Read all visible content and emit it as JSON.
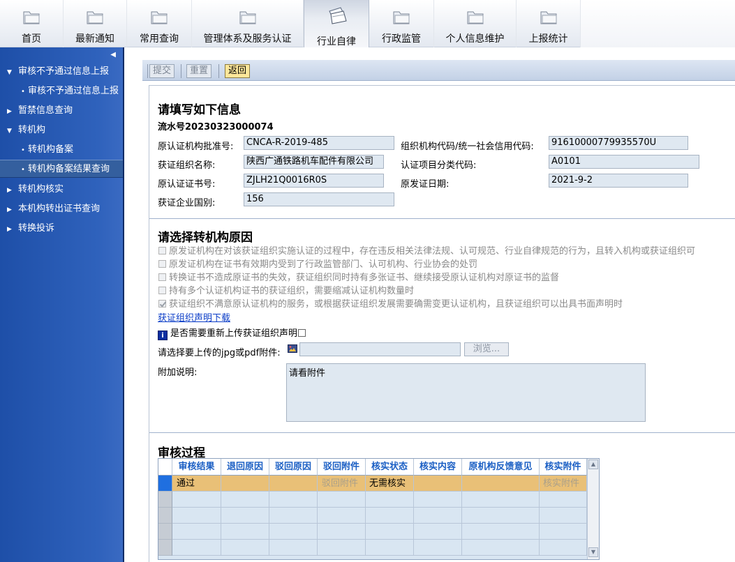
{
  "topnav": {
    "tabs": [
      {
        "label": "首页"
      },
      {
        "label": "最新通知"
      },
      {
        "label": "常用查询"
      },
      {
        "label": "管理体系及服务认证"
      },
      {
        "label": "行业自律"
      },
      {
        "label": "行政监管"
      },
      {
        "label": "个人信息维护"
      },
      {
        "label": "上报统计"
      }
    ],
    "active_tab": "行业自律"
  },
  "sidebar": {
    "collapse_glyph": "◀",
    "items": [
      {
        "label": "审核不予通过信息上报",
        "type": "group",
        "expanded": true
      },
      {
        "label": "审核不予通过信息上报",
        "type": "sub"
      },
      {
        "label": "暂禁信息查询",
        "type": "group",
        "expanded": false
      },
      {
        "label": "转机构",
        "type": "group",
        "expanded": true
      },
      {
        "label": "转机构备案",
        "type": "sub"
      },
      {
        "label": "转机构备案结果查询",
        "type": "sub",
        "selected": true
      },
      {
        "label": "转机构核实",
        "type": "group",
        "expanded": false
      },
      {
        "label": "本机构转出证书查询",
        "type": "group",
        "expanded": false
      },
      {
        "label": "转换投诉",
        "type": "group",
        "expanded": false
      }
    ]
  },
  "toolbar": {
    "submit_label": "提交",
    "reset_label": "重置",
    "back_label": "返回"
  },
  "form": {
    "section1_title": "请填写如下信息",
    "serial": "流水号20230323000074",
    "fields": {
      "orig_approval_label": "原认证机构批准号:",
      "orig_approval_value": "CNCA-R-2019-485",
      "org_code_label": "组织机构代码/统一社会信用代码:",
      "org_code_value": "91610000779935570U",
      "org_name_label": "获证组织名称:",
      "org_name_value": "陕西广通铁路机车配件有限公司",
      "category_label": "认证项目分类代码:",
      "category_value": "A0101",
      "cert_no_label": "原认证证书号:",
      "cert_no_value": "ZJLH21Q0016R0S",
      "issue_date_label": "原发证日期:",
      "issue_date_value": "2021-9-2",
      "country_label": "获证企业国别:",
      "country_value": "156"
    },
    "section2_title": "请选择转机构原因",
    "reasons": [
      {
        "text": "原发证机构在对该获证组织实施认证的过程中，存在违反相关法律法规、认可规范、行业自律规范的行为，且转入机构或获证组织可",
        "checked": false
      },
      {
        "text": "原发证机构在证书有效期内受到了行政监管部门、认可机构、行业协会的处罚",
        "checked": false
      },
      {
        "text": "转换证书不造成原证书的失效，获证组织同时持有多张证书、继续接受原认证机构对原证书的监督",
        "checked": false
      },
      {
        "text": "持有多个认证机构证书的获证组织，需要缩减认证机构数量时",
        "checked": false
      },
      {
        "text": "获证组织不满意原认证机构的服务，或根据获证组织发展需要确需变更认证机构，且获证组织可以出具书面声明时",
        "checked": true
      }
    ],
    "download_link": "获证组织声明下载",
    "info_icon_glyph": "i",
    "reupload_label": "是否需要重新上传获证组织声明",
    "upload_label": "请选择要上传的jpg或pdf附件:",
    "browse_label": "浏览...",
    "note_label": "附加说明:",
    "note_value": "请看附件",
    "section3_title": "审核过程"
  },
  "review_table": {
    "columns": [
      "审核结果",
      "退回原因",
      "驳回原因",
      "驳回附件",
      "核实状态",
      "核实内容",
      "原机构反馈意见",
      "核实附件"
    ],
    "rows": [
      [
        "通过",
        "",
        "",
        "驳回附件",
        "无需核实",
        "",
        "",
        "核实附件"
      ]
    ],
    "empty_rows": 4
  },
  "colors": {
    "sidebar_bg": "#2f62bc",
    "toolbar_bg": "#c3d1e6",
    "selected_row": "#e9c077",
    "header_text": "#1b5fc4",
    "field_bg": "#dfe8f1"
  }
}
